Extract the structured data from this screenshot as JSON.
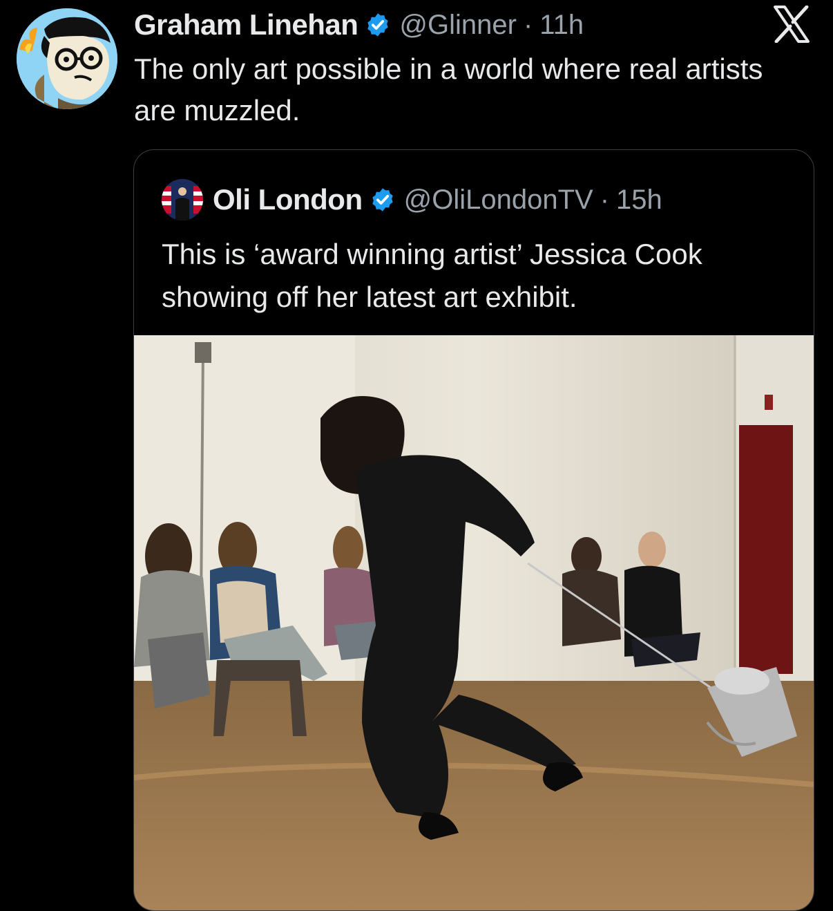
{
  "theme": {
    "background": "#000000",
    "text": "#e7e9ea",
    "secondary_text": "#9aa3ab",
    "verified_blue": "#1d9bf0",
    "card_border": "#3a3f44"
  },
  "tweet": {
    "author_name": "Graham Linehan",
    "verified_icon": "verified-badge-icon",
    "handle": "@Glinner",
    "separator": "·",
    "time": "11h",
    "text": "The only art possible in a world where real artists are muzzled."
  },
  "app": {
    "logo_icon": "x-logo-icon"
  },
  "quoted_tweet": {
    "author_name": "Oli London",
    "verified_icon": "verified-badge-icon",
    "handle": "@OliLondonTV",
    "separator": "·",
    "time": "15h",
    "text": "This is ‘award winning artist’ Jessica Cook showing off her latest art exhibit."
  }
}
